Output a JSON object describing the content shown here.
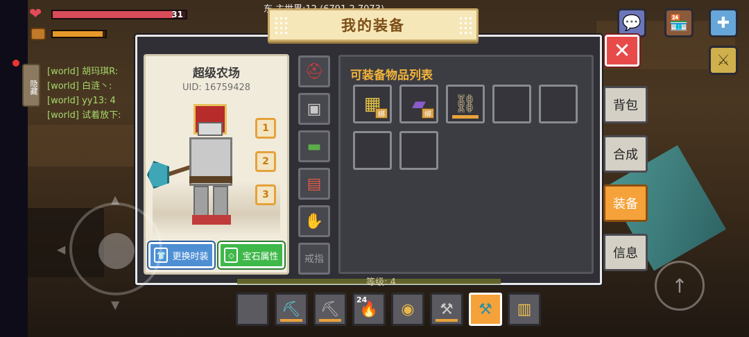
{
  "hud": {
    "hp_value": "31",
    "hp_fraction": 0.9,
    "hunger_fraction": 0.95,
    "coords": "东  主世界:12 (6791,2,7073)"
  },
  "side_hide_label": "隐藏",
  "chat": [
    {
      "text": "[world] 胡玛琪R:"
    },
    {
      "text": "[world] 白涟丶:"
    },
    {
      "text": "[world] yy13:  4"
    },
    {
      "text": "[world] 试着放下:"
    }
  ],
  "window": {
    "title": "我的装备"
  },
  "character": {
    "name": "超级农场",
    "uid": "UID: 16759428",
    "presets": [
      "1",
      "2",
      "3"
    ]
  },
  "buttons": {
    "change_outfit": "更换时装",
    "gem_attributes": "宝石属性"
  },
  "equip_slots": [
    {
      "icon": "helmet-icon",
      "glyph": "⛑"
    },
    {
      "icon": "chestplate-icon",
      "glyph": "🛡"
    },
    {
      "icon": "leggings-icon",
      "glyph": "▭"
    },
    {
      "icon": "boots-icon",
      "glyph": "👢"
    },
    {
      "icon": "gloves-icon",
      "glyph": "✋"
    },
    {
      "icon": "ring-slot",
      "label": "戒指"
    }
  ],
  "inventory": {
    "title": "可装备物品列表",
    "bind_label": "绑",
    "items": [
      {
        "icon": "gold-armor-icon",
        "glyph": "▦",
        "bound": true
      },
      {
        "icon": "purple-book-icon",
        "glyph": "📕",
        "bound": true
      },
      {
        "icon": "iron-boots-icon",
        "glyph": "⛓",
        "bound": false
      }
    ],
    "empty_cells": 4
  },
  "tabs": [
    {
      "label": "背包",
      "active": false
    },
    {
      "label": "合成",
      "active": false
    },
    {
      "label": "装备",
      "active": true
    },
    {
      "label": "信息",
      "active": false
    }
  ],
  "level_text": "等级: 4",
  "hotbar": [
    {
      "icon": "empty-slot",
      "glyph": "",
      "count": ""
    },
    {
      "icon": "diamond-pickaxe-icon",
      "glyph": "⛏",
      "count": ""
    },
    {
      "icon": "pickaxe-icon",
      "glyph": "⛏",
      "count": ""
    },
    {
      "icon": "torch-icon",
      "glyph": "🔥",
      "count": "24"
    },
    {
      "icon": "bread-icon",
      "glyph": "🍞",
      "count": ""
    },
    {
      "icon": "axe-icon",
      "glyph": "🪓",
      "count": ""
    },
    {
      "icon": "diamond-axe-icon",
      "glyph": "🪓",
      "count": "",
      "selected": true
    },
    {
      "icon": "beer-mug-icon",
      "glyph": "🍺",
      "count": ""
    }
  ],
  "colors": {
    "accent_orange": "#f5a23a",
    "title_gold": "#f2b43a",
    "close_red": "#e84a4a",
    "panel_bg": "#2f2f35"
  }
}
